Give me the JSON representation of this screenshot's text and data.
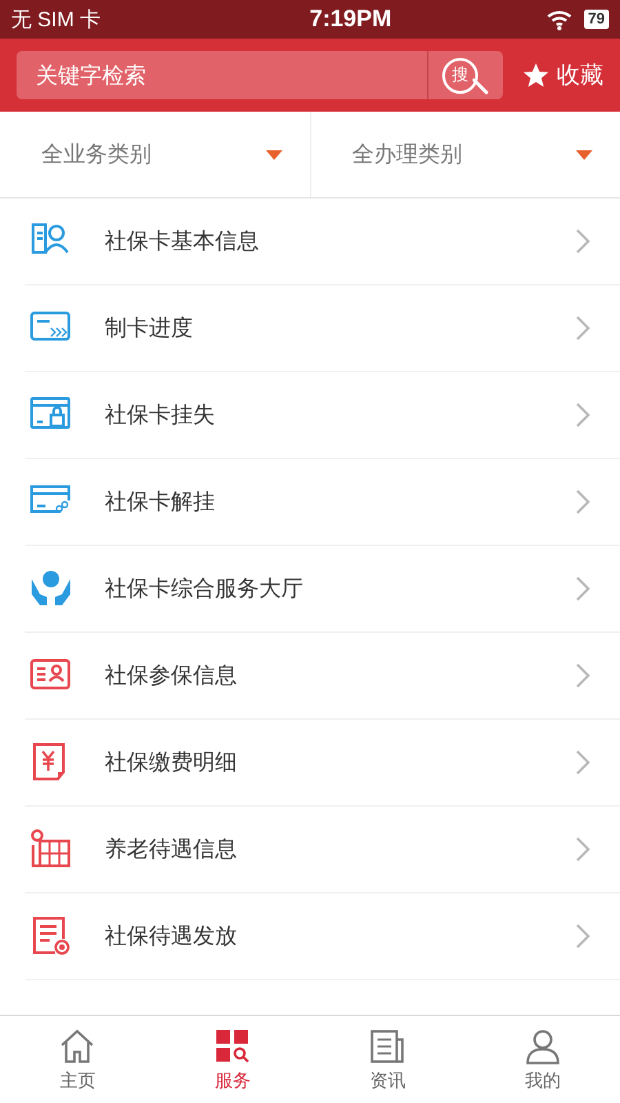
{
  "status_bar": {
    "carrier": "无 SIM 卡",
    "time": "7:19PM",
    "battery": "79"
  },
  "header": {
    "search": {
      "placeholder": "关键字检索",
      "button": "搜"
    },
    "favorite": "收藏"
  },
  "filters": [
    {
      "label": "全业务类别"
    },
    {
      "label": "全办理类别"
    }
  ],
  "items": [
    {
      "label": "社保卡基本信息",
      "color": "#2b9be0"
    },
    {
      "label": "制卡进度",
      "color": "#2b9be0"
    },
    {
      "label": "社保卡挂失",
      "color": "#2b9be0"
    },
    {
      "label": "社保卡解挂",
      "color": "#2b9be0"
    },
    {
      "label": "社保卡综合服务大厅",
      "color": "#2b9be0"
    },
    {
      "label": "社保参保信息",
      "color": "#e8474f"
    },
    {
      "label": "社保缴费明细",
      "color": "#e8474f"
    },
    {
      "label": "养老待遇信息",
      "color": "#e8474f"
    },
    {
      "label": "社保待遇发放",
      "color": "#e8474f"
    }
  ],
  "tabs": [
    {
      "label": "主页",
      "selected": false
    },
    {
      "label": "服务",
      "selected": true
    },
    {
      "label": "资讯",
      "selected": false
    },
    {
      "label": "我的",
      "selected": false
    }
  ]
}
